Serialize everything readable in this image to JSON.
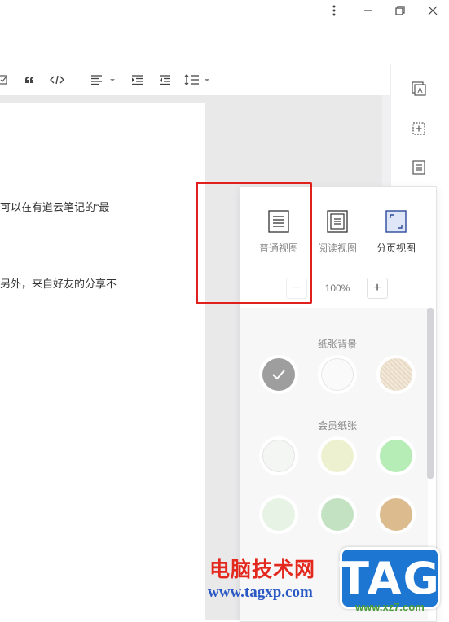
{
  "window": {
    "controls": [
      "more-options",
      "minimize",
      "restore",
      "close"
    ]
  },
  "toolbar": {
    "tools": [
      "checkbox",
      "quote",
      "code",
      "align-left",
      "indent-increase",
      "indent-decrease",
      "line-spacing"
    ]
  },
  "document": {
    "line1": "可以在有道云笔记的“最",
    "line2": "另外，来自好友的分享不"
  },
  "view_panel": {
    "views": [
      {
        "label": "普通视图",
        "icon": "normal-view-icon"
      },
      {
        "label": "阅读视图",
        "icon": "reading-view-icon"
      },
      {
        "label": "分页视图",
        "icon": "page-view-icon"
      }
    ],
    "zoom": {
      "minus": "−",
      "value": "100%",
      "plus": "+"
    },
    "paper_bg_title": "纸张背景",
    "member_paper_title": "会员纸张"
  },
  "colors": {
    "highlight": "#e0201c",
    "accent": "#1d76d2"
  },
  "watermark": {
    "site_cn": "电脑技术网",
    "site_url": "www.tagxp.com",
    "logo_text": "TAG",
    "sub_url": "www.xz7.com"
  }
}
